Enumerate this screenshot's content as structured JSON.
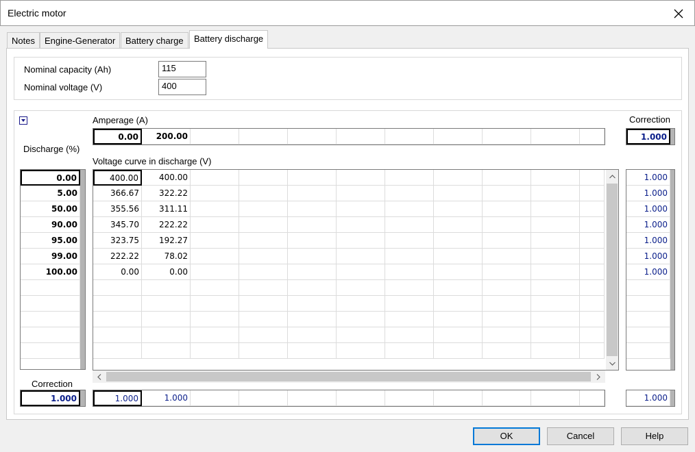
{
  "window": {
    "title": "Electric motor"
  },
  "tabs": [
    "Notes",
    "Engine-Generator",
    "Battery charge",
    "Battery discharge"
  ],
  "nominal": {
    "capacity_label": "Nominal capacity (Ah)",
    "capacity_value": "115",
    "voltage_label": "Nominal voltage (V)",
    "voltage_value": "400"
  },
  "labels": {
    "amperage": "Amperage (A)",
    "correction_top": "Correction",
    "discharge": "Discharge (%)",
    "voltage_curve": "Voltage curve in discharge (V)",
    "correction_bottom": "Correction"
  },
  "amperage": [
    "0.00",
    "200.00"
  ],
  "correction_top_value": "1.000",
  "discharge_percent": [
    "0.00",
    "5.00",
    "50.00",
    "90.00",
    "95.00",
    "99.00",
    "100.00"
  ],
  "voltage_rows": [
    [
      "400.00",
      "400.00"
    ],
    [
      "366.67",
      "322.22"
    ],
    [
      "355.56",
      "311.11"
    ],
    [
      "345.70",
      "222.22"
    ],
    [
      "323.75",
      "192.27"
    ],
    [
      "222.22",
      "78.02"
    ],
    [
      "0.00",
      "0.00"
    ]
  ],
  "row_correction": [
    "1.000",
    "1.000",
    "1.000",
    "1.000",
    "1.000",
    "1.000",
    "1.000"
  ],
  "bottom": {
    "discharge_correction": "1.000",
    "column_correction": [
      "1.000",
      "1.000"
    ],
    "corner_correction": "1.000"
  },
  "buttons": {
    "ok": "OK",
    "cancel": "Cancel",
    "help": "Help"
  },
  "colors": {
    "value_blue": "#0a1e8a",
    "accent": "#0078d7"
  }
}
